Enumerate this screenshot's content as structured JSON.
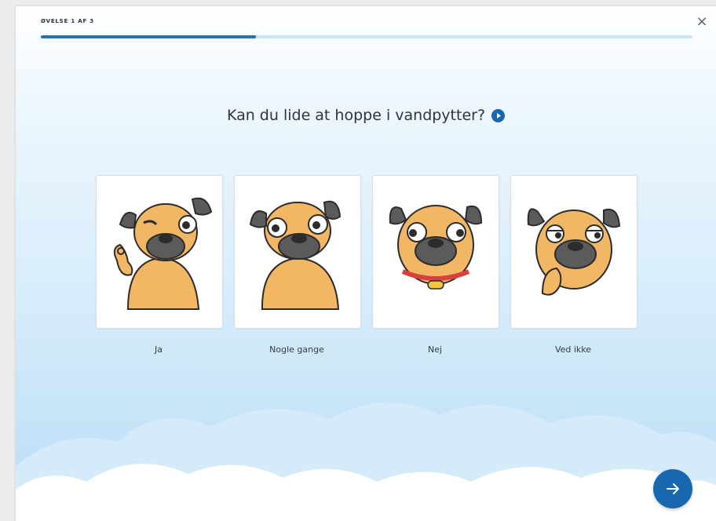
{
  "header": {
    "step_label": "ØVELSE 1 AF 3",
    "close_symbol": "×",
    "progress": 0.33
  },
  "question": {
    "text": "Kan du lide at hoppe i vandpytter?",
    "audio_icon": "play-audio-icon"
  },
  "options": [
    {
      "label": "Ja",
      "image": "pug-winking-ok-hand"
    },
    {
      "label": "Nogle gange",
      "image": "pug-wide-eyed"
    },
    {
      "label": "Nej",
      "image": "pug-with-collar-side-eyes"
    },
    {
      "label": "Ved ikke",
      "image": "pug-thinking-hand-on-chin"
    }
  ],
  "footer": {
    "next_icon": "arrow-right-icon"
  },
  "colors": {
    "accent": "#1768ae",
    "progress_track": "#c9e5f8",
    "progress_fill": "#1c76b4"
  }
}
